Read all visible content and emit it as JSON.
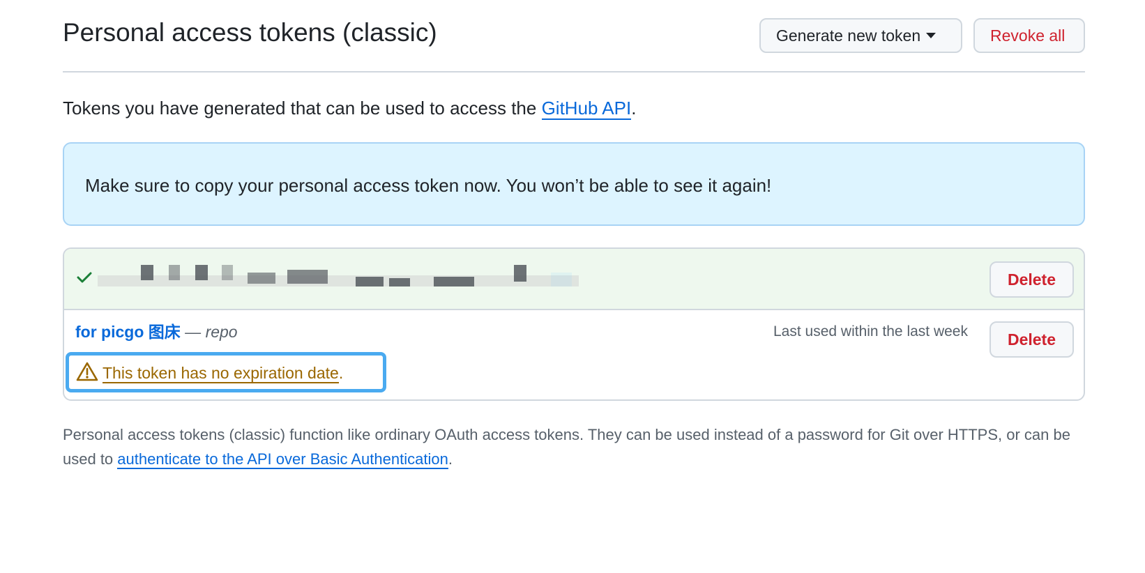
{
  "header": {
    "title": "Personal access tokens (classic)",
    "generate_label": "Generate new token",
    "revoke_label": "Revoke all"
  },
  "intro": {
    "text": "Tokens you have generated that can be used to access the ",
    "link_text": "GitHub API",
    "suffix": "."
  },
  "flash": {
    "message": "Make sure to copy your personal access token now. You won’t be able to see it again!"
  },
  "tokens": [
    {
      "status_icon": "check-icon",
      "value_obscured": true,
      "delete_label": "Delete"
    },
    {
      "name": "for picgo 图床",
      "separator": " — ",
      "scope": "repo",
      "last_used": "Last used within the last week",
      "delete_label": "Delete",
      "warning_icon": "alert-icon",
      "warning_link": "This token has no expiration date",
      "warning_suffix": "."
    }
  ],
  "footnote": {
    "text": "Personal access tokens (classic) function like ordinary OAuth access tokens. They can be used instead of a password for Git over HTTPS, or can be used to ",
    "link_text": "authenticate to the API over Basic Authentication",
    "suffix": "."
  },
  "colors": {
    "link": "#0969da",
    "danger": "#cf222e",
    "warning": "#9a6700",
    "flash_bg": "#ddf4ff",
    "success_bg": "#eef8ee",
    "highlight_border": "#4aaaf0"
  }
}
